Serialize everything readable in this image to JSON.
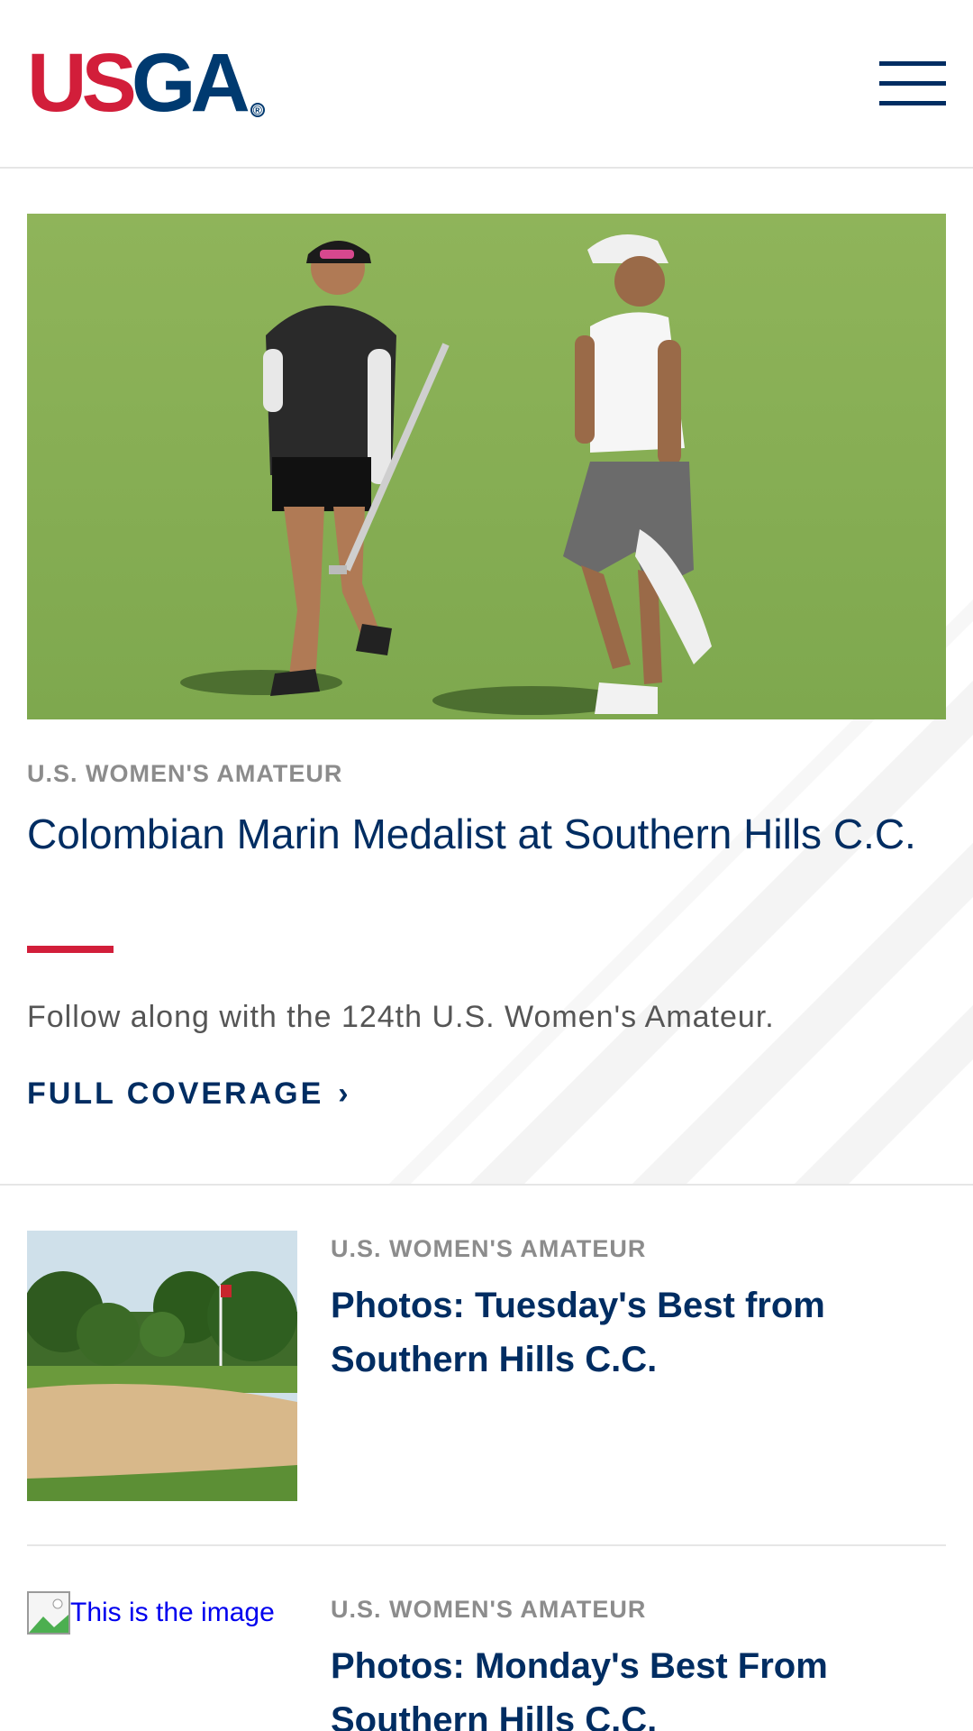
{
  "header": {
    "logo_text_us": "US",
    "logo_text_ga": "GA",
    "logo_reg": "®",
    "menu_icon": "hamburger-menu-icon"
  },
  "hero": {
    "image_alt": "Golfer and caddie walking on green",
    "eyebrow": "U.S. WOMEN'S AMATEUR",
    "title": "Colombian Marin Medalist at Southern Hills C.C.",
    "description": "Follow along with the 124th U.S. Women's Amateur.",
    "cta_label": "FULL COVERAGE",
    "cta_icon": "chevron-right-icon",
    "accent_color": "#d21e3a"
  },
  "articles": [
    {
      "eyebrow": "U.S. WOMEN'S AMATEUR",
      "title": "Photos: Tuesday's Best from Southern Hills C.C.",
      "image_alt": "Bunker and trees on golf course"
    },
    {
      "eyebrow": "U.S. WOMEN'S AMATEUR",
      "title": "Photos: Monday's Best From Southern Hills C.C.",
      "image_alt_text": "This is the image"
    }
  ],
  "colors": {
    "brand_navy": "#002d62",
    "brand_red": "#d21e3a",
    "eyebrow_gray": "#8c8c8c"
  }
}
